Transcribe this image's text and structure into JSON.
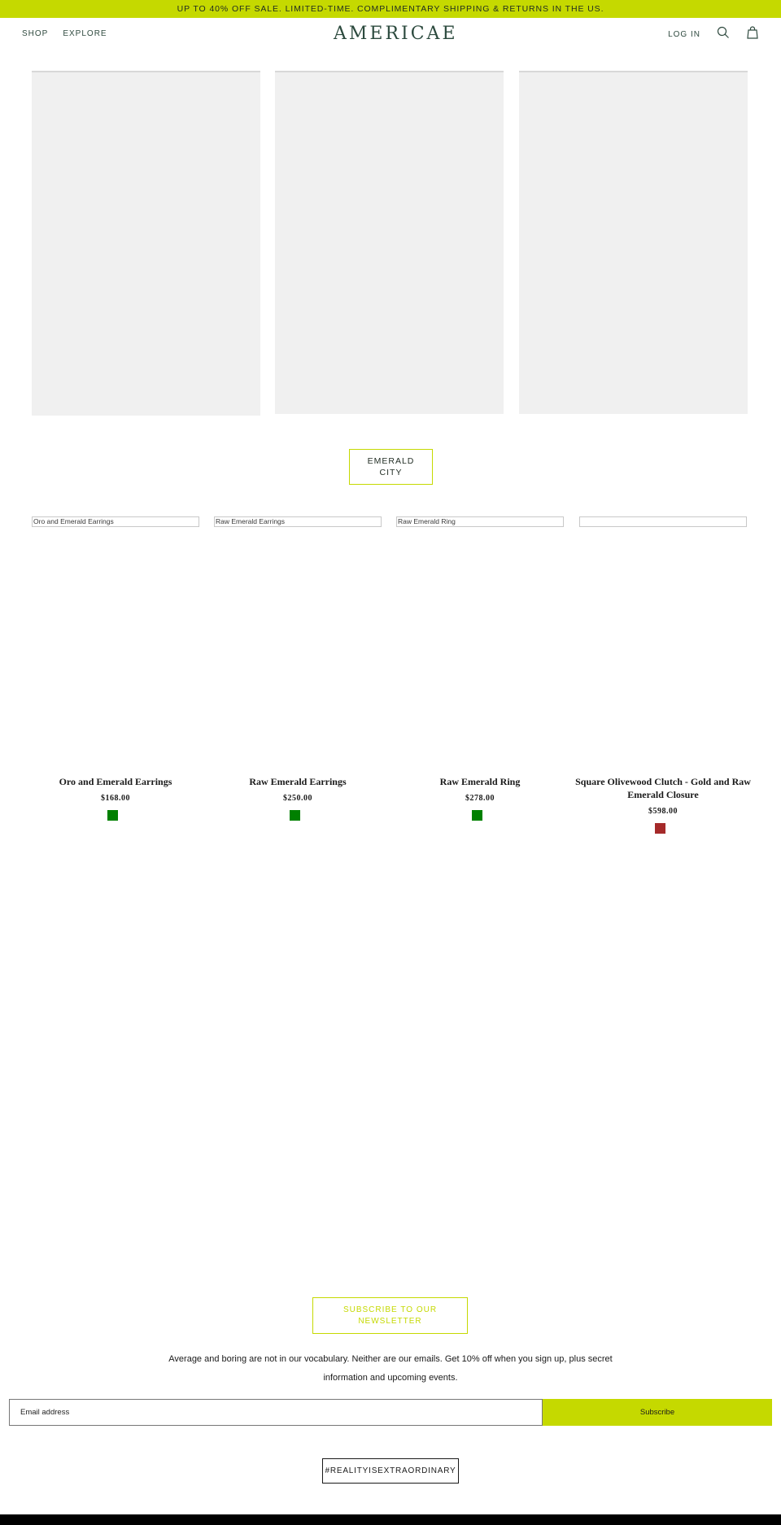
{
  "announcement": "UP TO 40% OFF SALE. LIMITED-TIME. COMPLIMENTARY SHIPPING & RETURNS IN THE US.",
  "header": {
    "nav": [
      "SHOP",
      "EXPLORE"
    ],
    "logo": "AMERICAE",
    "login": "LOG IN",
    "icons": [
      "search-icon",
      "cart-icon"
    ]
  },
  "collection": {
    "label": "EMERALD\nCITY"
  },
  "products": [
    {
      "image_alt": "Oro and Emerald Earrings",
      "title": "Oro and Emerald Earrings",
      "price": "$168.00",
      "swatch": "#008000"
    },
    {
      "image_alt": "Raw Emerald Earrings",
      "title": "Raw Emerald Earrings",
      "price": "$250.00",
      "swatch": "#008000"
    },
    {
      "image_alt": "Raw Emerald Ring",
      "title": "Raw Emerald Ring",
      "price": "$278.00",
      "swatch": "#008000"
    },
    {
      "image_alt": "",
      "title": "Square Olivewood Clutch - Gold and Raw Emerald Closure",
      "price": "$598.00",
      "swatch": "#a52a2a"
    }
  ],
  "newsletter": {
    "heading": "SUBSCRIBE TO OUR\nNEWSLETTER",
    "text": "Average and boring are not in our vocabulary. Neither are our emails. Get 10% off when you sign up, plus secret information and upcoming events.",
    "placeholder": "Email address",
    "button": "Subscribe"
  },
  "hashtag": "#REALITYISEXTRAORDINARY",
  "colors": {
    "accent": "#c5d900",
    "brand": "#2c4a3e"
  }
}
